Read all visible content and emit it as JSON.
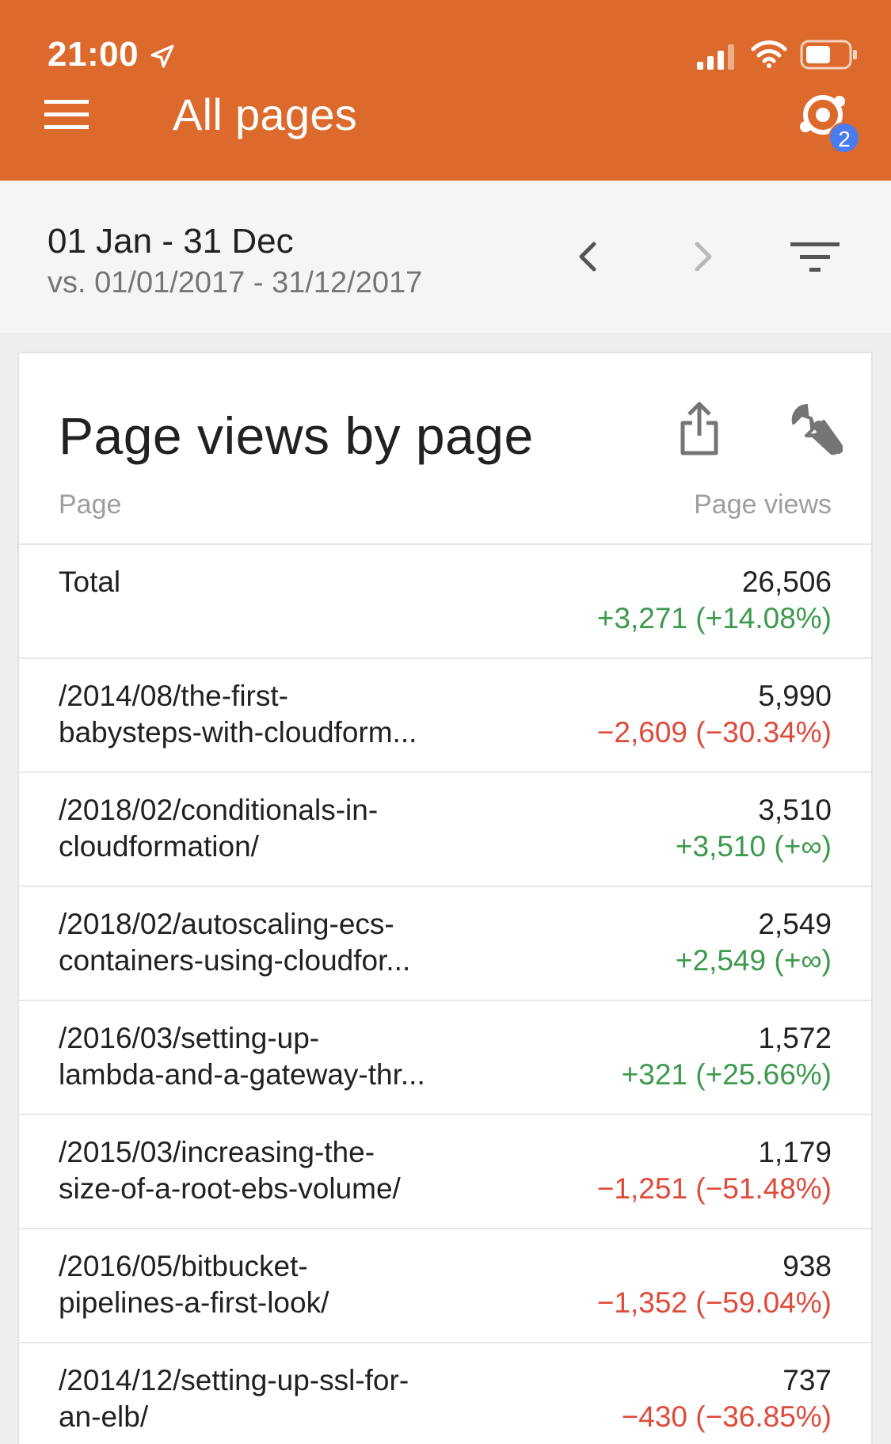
{
  "status_bar": {
    "time": "21:00",
    "icons": [
      "location-arrow-icon",
      "signal-icon",
      "wifi-icon",
      "battery-icon"
    ]
  },
  "app_bar": {
    "title": "All pages",
    "menu_icon": "menu-icon",
    "realtime_icon": "realtime-icon",
    "realtime_badge": "2",
    "background_color": "#dc6a2c",
    "badge_color": "#4a7cf0"
  },
  "date_range": {
    "primary": "01 Jan - 31 Dec",
    "compare": "vs. 01/01/2017 - 31/12/2017",
    "prev_icon": "chevron-left-icon",
    "next_icon": "chevron-right-icon",
    "filter_icon": "filter-icon"
  },
  "card": {
    "title": "Page views by page",
    "share_icon": "share-icon",
    "wrench_icon": "wrench-icon",
    "col_page": "Page",
    "col_views": "Page views",
    "positive_color": "#3c9a4d",
    "negative_color": "#df4a3a",
    "rows": [
      {
        "line1": "Total",
        "line2": "",
        "value": "26,506",
        "change": "+3,271 (+14.08%)",
        "trend": "pos"
      },
      {
        "line1": "/2014/08/the-first-",
        "line2": "babysteps-with-cloudform...",
        "value": "5,990",
        "change": "−2,609 (−30.34%)",
        "trend": "neg"
      },
      {
        "line1": "/2018/02/conditionals-in-",
        "line2": "cloudformation/",
        "value": "3,510",
        "change": "+3,510 (+∞)",
        "trend": "pos"
      },
      {
        "line1": "/2018/02/autoscaling-ecs-",
        "line2": "containers-using-cloudfor...",
        "value": "2,549",
        "change": "+2,549 (+∞)",
        "trend": "pos"
      },
      {
        "line1": "/2016/03/setting-up-",
        "line2": "lambda-and-a-gateway-thr...",
        "value": "1,572",
        "change": "+321 (+25.66%)",
        "trend": "pos"
      },
      {
        "line1": "/2015/03/increasing-the-",
        "line2": "size-of-a-root-ebs-volume/",
        "value": "1,179",
        "change": "−1,251 (−51.48%)",
        "trend": "neg"
      },
      {
        "line1": "/2016/05/bitbucket-",
        "line2": "pipelines-a-first-look/",
        "value": "938",
        "change": "−1,352 (−59.04%)",
        "trend": "neg"
      },
      {
        "line1": "/2014/12/setting-up-ssl-for-",
        "line2": "an-elb/",
        "value": "737",
        "change": "−430 (−36.85%)",
        "trend": "neg"
      }
    ]
  }
}
